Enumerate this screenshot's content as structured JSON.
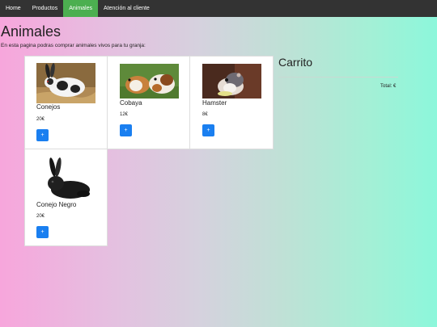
{
  "nav": {
    "items": [
      {
        "label": "Home"
      },
      {
        "label": "Productos"
      },
      {
        "label": "Animales"
      },
      {
        "label": "Atención al cliente"
      }
    ],
    "active_color": "#4caf50",
    "bg_color": "#333333"
  },
  "page": {
    "title": "Animales",
    "intro": "En esta pagina podras comprar animales vivos para tu granja:"
  },
  "products": [
    {
      "name": "Conejos",
      "price": "20€",
      "add_label": "+",
      "image_icon": "rabbit-photo"
    },
    {
      "name": "Cobaya",
      "price": "12€",
      "add_label": "+",
      "image_icon": "guinea-pig-photo"
    },
    {
      "name": "Hamster",
      "price": "8€",
      "add_label": "+",
      "image_icon": "hamster-photo"
    },
    {
      "name": "Conejo Negro",
      "price": "20€",
      "add_label": "+",
      "image_icon": "black-rabbit-photo"
    }
  ],
  "cart": {
    "title": "Carrito",
    "total_label": "Total: €"
  },
  "colors": {
    "button": "#1a7ff0"
  }
}
